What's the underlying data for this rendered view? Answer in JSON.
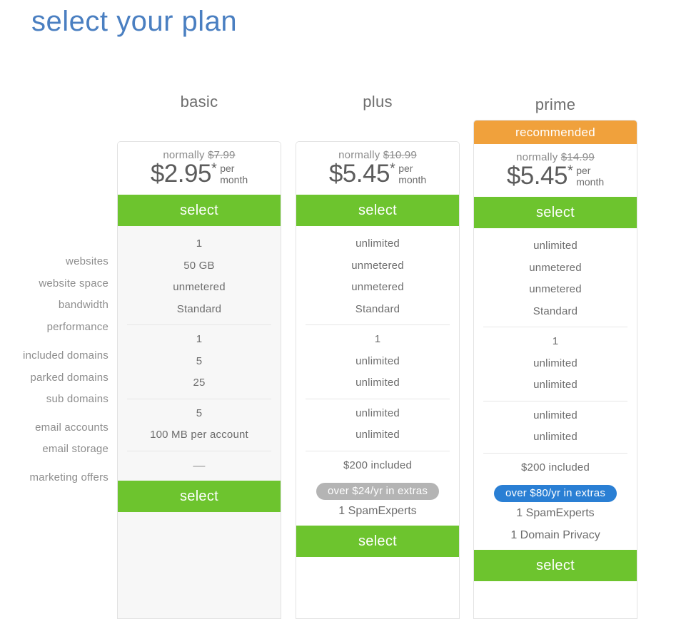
{
  "page": {
    "title": "select your plan"
  },
  "features": {
    "groups": [
      {
        "labels": [
          "websites",
          "website space",
          "bandwidth",
          "performance"
        ]
      },
      {
        "labels": [
          "included domains",
          "parked domains",
          "sub domains"
        ]
      },
      {
        "labels": [
          "email accounts",
          "email storage"
        ]
      },
      {
        "labels": [
          "marketing offers"
        ]
      }
    ]
  },
  "colors": {
    "title_blue": "#4a7fc1",
    "select_green": "#6dc42e",
    "recommended_orange": "#f0a13c",
    "pill_gray": "#b4b4b4",
    "pill_blue": "#2a7fd4",
    "basic_bg": "#f7f7f7"
  },
  "plans": [
    {
      "id": "basic",
      "name": "basic",
      "badge": null,
      "normally_label": "normally",
      "normally_price": "$7.99",
      "price": "$2.95",
      "star": "*",
      "per_line1": "per",
      "per_line2": "month",
      "select_label": "select",
      "select_label_bottom": "select",
      "groups": [
        {
          "values": [
            "1",
            "50 GB",
            "unmetered",
            "Standard"
          ]
        },
        {
          "values": [
            "1",
            "5",
            "25"
          ]
        },
        {
          "values": [
            "5",
            "100 MB per account"
          ]
        },
        {
          "values": [
            "—"
          ]
        }
      ],
      "extras_pill": null,
      "extras_items": []
    },
    {
      "id": "plus",
      "name": "plus",
      "badge": null,
      "normally_label": "normally",
      "normally_price": "$10.99",
      "price": "$5.45",
      "star": "*",
      "per_line1": "per",
      "per_line2": "month",
      "select_label": "select",
      "select_label_bottom": "select",
      "groups": [
        {
          "values": [
            "unlimited",
            "unmetered",
            "unmetered",
            "Standard"
          ]
        },
        {
          "values": [
            "1",
            "unlimited",
            "unlimited"
          ]
        },
        {
          "values": [
            "unlimited",
            "unlimited"
          ]
        },
        {
          "values": [
            "$200 included"
          ]
        }
      ],
      "extras_pill": "over $24/yr in extras",
      "extras_items": [
        "1 SpamExperts"
      ]
    },
    {
      "id": "prime",
      "name": "prime",
      "badge": "recommended",
      "normally_label": "normally",
      "normally_price": "$14.99",
      "price": "$5.45",
      "star": "*",
      "per_line1": "per",
      "per_line2": "month",
      "select_label": "select",
      "select_label_bottom": "select",
      "groups": [
        {
          "values": [
            "unlimited",
            "unmetered",
            "unmetered",
            "Standard"
          ]
        },
        {
          "values": [
            "1",
            "unlimited",
            "unlimited"
          ]
        },
        {
          "values": [
            "unlimited",
            "unlimited"
          ]
        },
        {
          "values": [
            "$200 included"
          ]
        }
      ],
      "extras_pill": "over $80/yr in extras",
      "extras_items": [
        "1 SpamExperts",
        "1 Domain Privacy"
      ]
    }
  ]
}
